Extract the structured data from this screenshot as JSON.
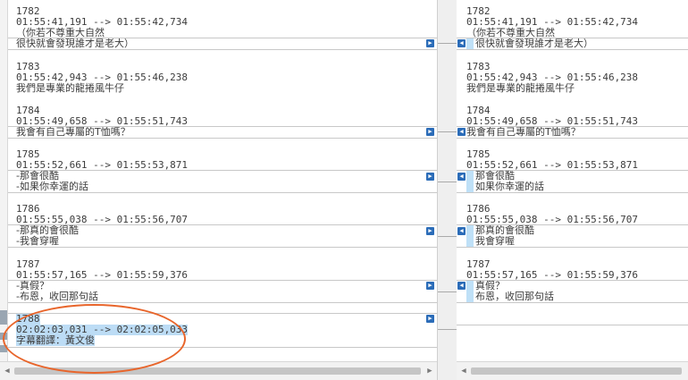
{
  "left": {
    "blocks": [
      {
        "num": "1782",
        "time": "01:55:41,191 --> 01:55:42,734",
        "lines": [
          "（你若不尊重大自然",
          "很快就會發現誰才是老大）"
        ]
      },
      {
        "num": "1783",
        "time": "01:55:42,943 --> 01:55:46,238",
        "lines": [
          "我們是專業的龍捲風牛仔"
        ]
      },
      {
        "num": "1784",
        "time": "01:55:49,658 --> 01:55:51,743",
        "lines": [
          "我會有自己專屬的T恤嗎？"
        ]
      },
      {
        "num": "1785",
        "time": "01:55:52,661 --> 01:55:53,871",
        "lines": [
          "-那會很酷",
          "-如果你幸運的話"
        ]
      },
      {
        "num": "1786",
        "time": "01:55:55,038 --> 01:55:56,707",
        "lines": [
          "-那真的會很酷",
          "-我會穿喔"
        ]
      },
      {
        "num": "1787",
        "time": "01:55:57,165 --> 01:55:59,376",
        "lines": [
          "-真假？",
          "-布恩，收回那句話"
        ]
      },
      {
        "num": "1788",
        "time": "02:02:03,031 --> 02:02:05,033",
        "lines": [
          "字幕翻譯：黃文俊"
        ]
      }
    ]
  },
  "right": {
    "blocks": [
      {
        "num": "1782",
        "time": "01:55:41,191 --> 01:55:42,734",
        "lines": [
          "（你若不尊重大自然",
          "很快就會發現誰才是老大）"
        ]
      },
      {
        "num": "1783",
        "time": "01:55:42,943 --> 01:55:46,238",
        "lines": [
          "我們是專業的龍捲風牛仔"
        ]
      },
      {
        "num": "1784",
        "time": "01:55:49,658 --> 01:55:51,743",
        "lines": [
          "我會有自己專屬的T恤嗎？"
        ]
      },
      {
        "num": "1785",
        "time": "01:55:52,661 --> 01:55:53,871",
        "lines": [
          "那會很酷",
          "如果你幸運的話"
        ]
      },
      {
        "num": "1786",
        "time": "01:55:55,038 --> 01:55:56,707",
        "lines": [
          "那真的會很酷",
          "我會穿喔"
        ]
      },
      {
        "num": "1787",
        "time": "01:55:57,165 --> 01:55:59,376",
        "lines": [
          "真假？",
          "布恩，收回那句話"
        ]
      }
    ]
  },
  "icons": {
    "left_arrow": "arrow-right-icon",
    "right_arrow": "arrow-left-icon"
  },
  "colors": {
    "highlight": "#bcdcf5",
    "button": "#2b6cb8",
    "annotation": "#e8652b"
  }
}
